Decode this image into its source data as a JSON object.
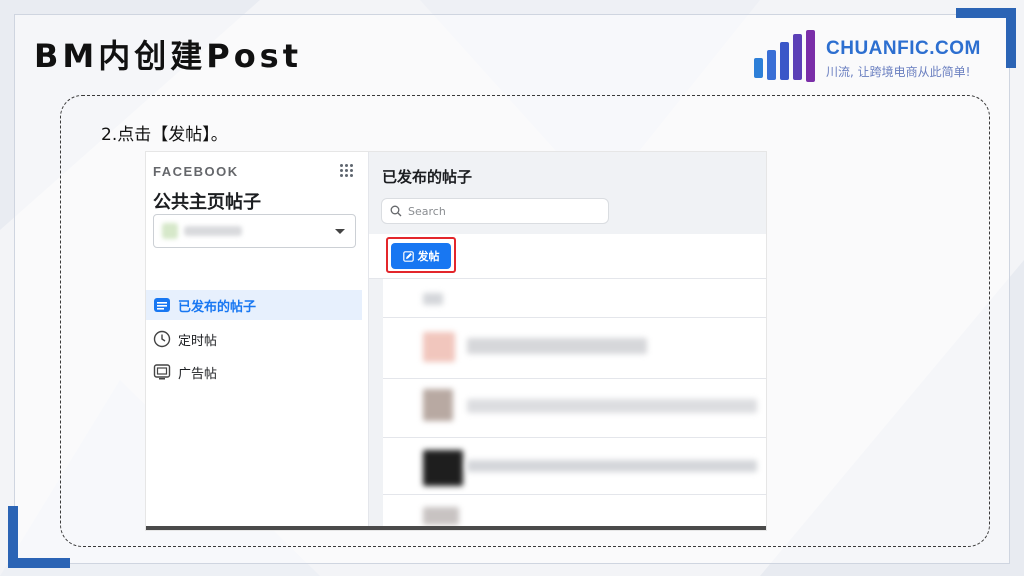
{
  "slide": {
    "title": "BM内创建Post",
    "step_text": "2.点击【发帖】。"
  },
  "logo": {
    "name": "CHUANFIC.COM",
    "slogan": "川流, 让跨境电商从此简单!",
    "bar_colors": [
      "#2d7fd8",
      "#3a57c8",
      "#5b3fb6",
      "#7a2ea8"
    ]
  },
  "facebook": {
    "brand": "FACEBOOK",
    "section_title": "公共主页帖子",
    "apps_icon": "grid-dots-icon",
    "nav": [
      {
        "label": "已发布的帖子",
        "icon": "list-icon",
        "active": true
      },
      {
        "label": "定时帖",
        "icon": "clock-icon",
        "active": false
      },
      {
        "label": "广告帖",
        "icon": "ad-screen-icon",
        "active": false
      }
    ],
    "main_title": "已发布的帖子",
    "search_placeholder": "Search",
    "post_button_label": "发帖",
    "accent_color": "#1877f2",
    "highlight_color": "#e3262b"
  }
}
